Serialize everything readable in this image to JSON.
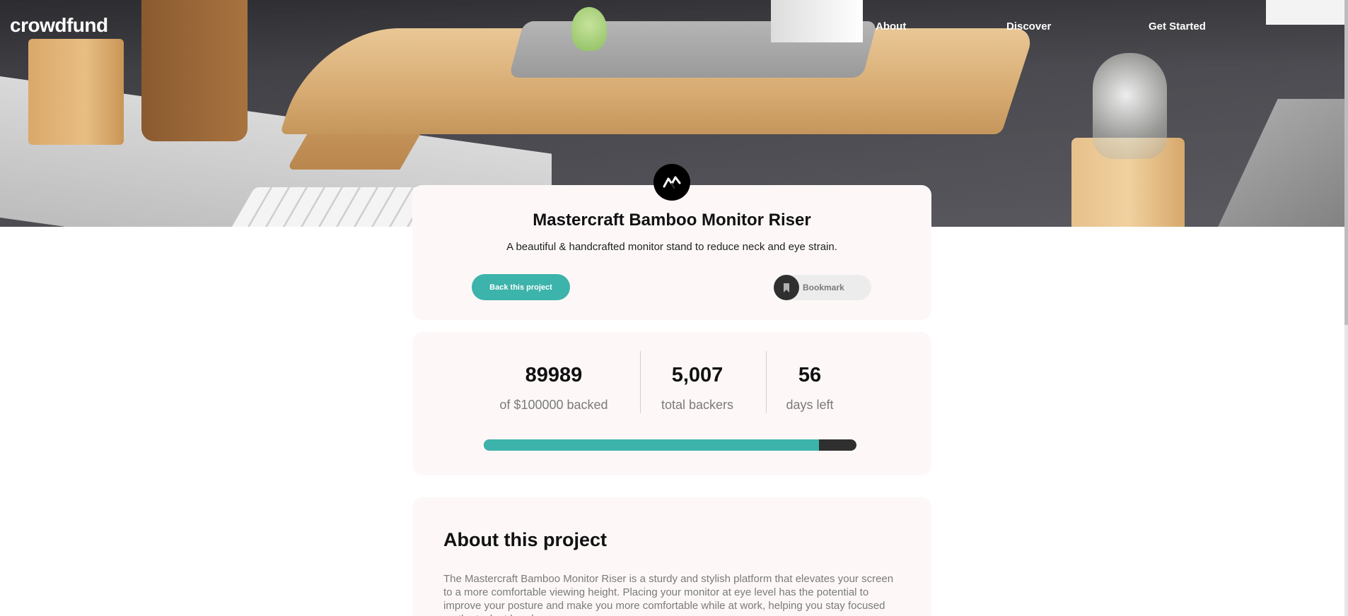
{
  "header": {
    "logo": "crowdfund",
    "nav": {
      "about": "About",
      "discover": "Discover",
      "get_started": "Get Started"
    }
  },
  "project": {
    "logo_icon": "mastercraft-logo-icon",
    "title": "Mastercraft Bamboo Monitor Riser",
    "subtitle": "A beautiful & handcrafted monitor stand to reduce neck and eye strain.",
    "back_button": "Back this project",
    "bookmark_label": "Bookmark",
    "bookmark_icon": "bookmark-icon"
  },
  "stats": {
    "backed_amount": "89989",
    "backed_label": "of $100000 backed",
    "backers_count": "5,007",
    "backers_label": "total backers",
    "days_count": "56",
    "days_label": "days left",
    "progress_fraction": 0.89989
  },
  "about": {
    "title": "About this project",
    "text": "The Mastercraft Bamboo Monitor Riser is a sturdy and stylish platform that elevates your screen to a more comfortable viewing height. Placing your monitor at eye level has the potential to improve your posture and make you more comfortable while at work, helping you stay focused on the task at hand."
  },
  "colors": {
    "accent": "#3cb3ab",
    "dark": "#2f2f2f",
    "muted_text": "#7a7a7a",
    "card_bg": "#fdf8f7"
  }
}
